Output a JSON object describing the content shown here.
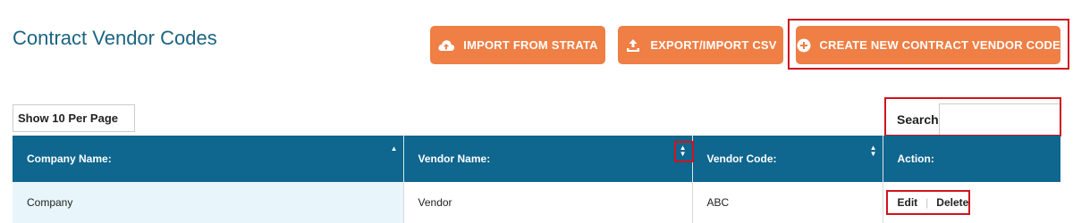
{
  "page": {
    "title": "Contract Vendor Codes"
  },
  "toolbar": {
    "import_label": "IMPORT FROM STRATA",
    "export_label": "EXPORT/IMPORT CSV",
    "create_label": "CREATE NEW CONTRACT VENDOR CODE",
    "button_color": "#ef7f45",
    "import_icon": "cloud-upload-icon",
    "export_icon": "upload-tray-icon",
    "create_icon": "plus-circle-icon"
  },
  "controls": {
    "per_page_label": "Show 10 Per Page",
    "search_label": "Search",
    "search_value": ""
  },
  "table": {
    "header_color": "#0f668e",
    "columns": [
      {
        "label": "Company Name:",
        "sort": "ascending"
      },
      {
        "label": "Vendor Name:",
        "sort": "both"
      },
      {
        "label": "Vendor Code:",
        "sort": "both"
      },
      {
        "label": "Action:",
        "sort": "none"
      }
    ],
    "rows": [
      {
        "company": "Company",
        "vendor": "Vendor",
        "code": "ABC",
        "edit_label": "Edit",
        "delete_label": "Delete"
      }
    ]
  },
  "highlight_color": "#d0141c"
}
